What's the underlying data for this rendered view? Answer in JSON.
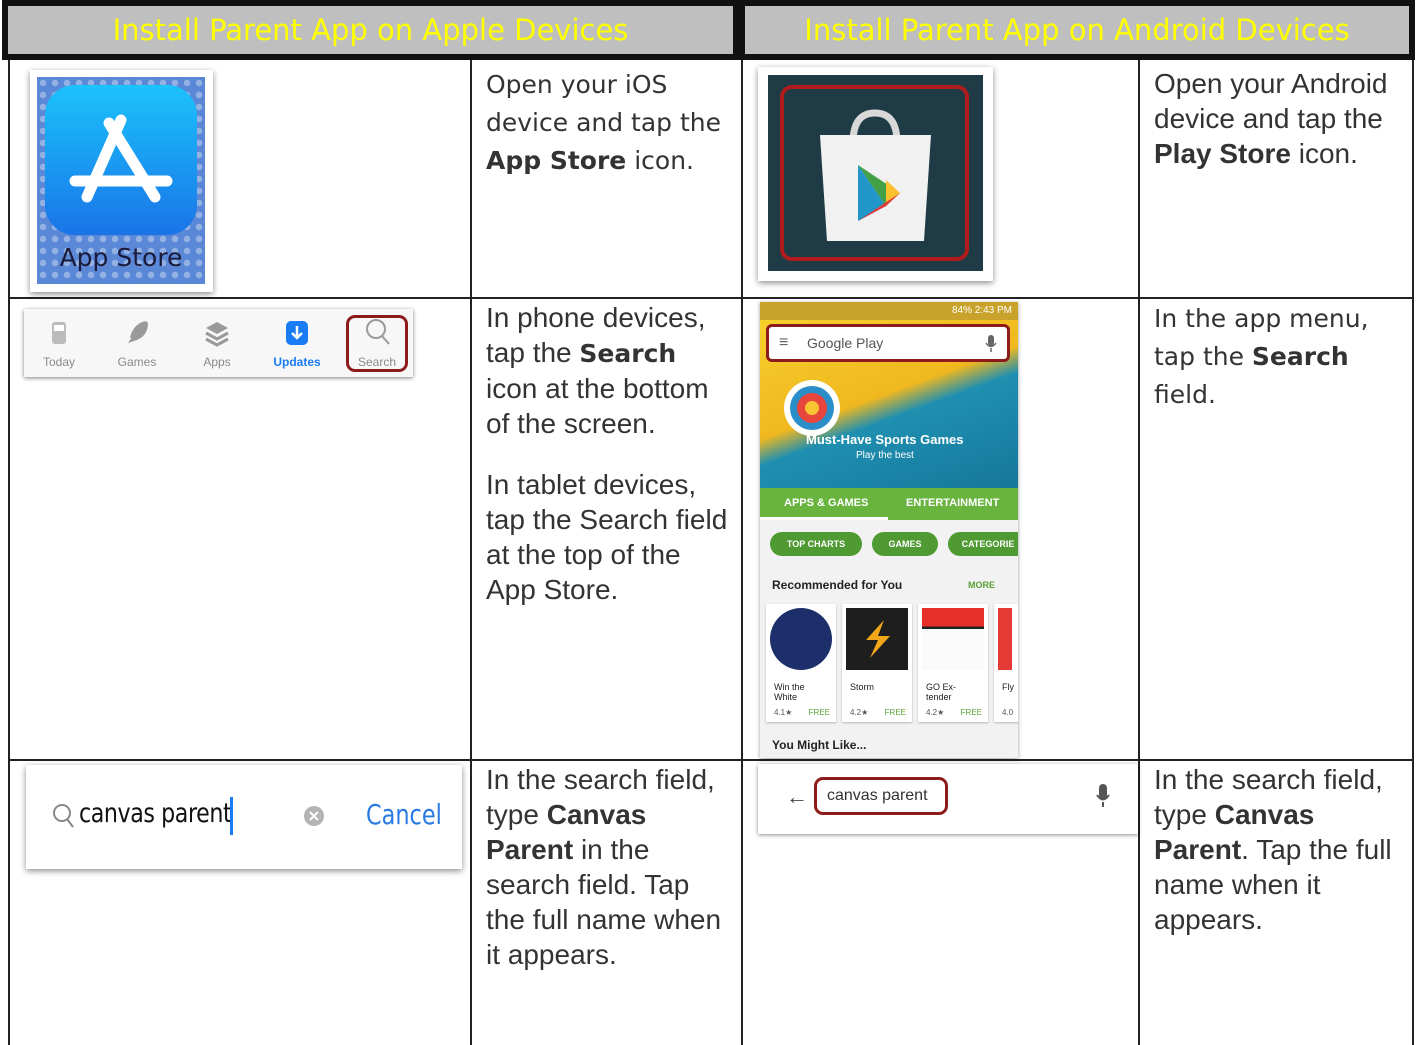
{
  "headers": {
    "apple": "Install Parent App on Apple Devices",
    "android": "Install Parent App on Android Devices"
  },
  "colors": {
    "header_bg": "#bfbfbf",
    "header_text": "#ffff00",
    "highlight": "#8e1b1b"
  },
  "apple": {
    "row1": {
      "icon_label": "App Store",
      "text_pre": "Open your iOS device and tap the",
      "text_bold": "App Store",
      "text_post": "icon."
    },
    "row2": {
      "tabs": [
        "Today",
        "Games",
        "Apps",
        "Updates",
        "Search"
      ],
      "phone_pre": "In phone devices, tap the",
      "phone_bold": "Search",
      "phone_post": "icon at the bottom of the screen.",
      "tablet": "In tablet devices, tap the Search field at the top of the App Store."
    },
    "row3": {
      "search_value": "canvas parent",
      "cancel_label": "Cancel",
      "text_pre": "In the search field, type",
      "text_bold": "Canvas Parent",
      "text_post": "in the search field. Tap the full name when it appears."
    }
  },
  "android": {
    "row1": {
      "text_pre": "Open your Android device and tap the",
      "text_bold": "Play Store",
      "text_post": "icon."
    },
    "row2": {
      "status": "84% 2:43 PM",
      "search_placeholder": "Google Play",
      "banner_title": "Must-Have Sports Games",
      "banner_sub": "Play the best",
      "tab_apps": "APPS & GAMES",
      "tab_ent": "ENTERTAINMENT",
      "chip_charts": "TOP CHARTS",
      "chip_games": "GAMES",
      "chip_cat": "CATEGORIE",
      "rec_heading": "Recommended for You",
      "more": "MORE",
      "apps": [
        {
          "name": "Win the White",
          "rating": "4.1★",
          "price": "FREE"
        },
        {
          "name": "Storm",
          "rating": "4.2★",
          "price": "FREE"
        },
        {
          "name": "GO Ex-tender",
          "rating": "4.2★",
          "price": "FREE"
        },
        {
          "name": "Fly",
          "rating": "4.0",
          "price": ""
        }
      ],
      "might_like": "You Might Like...",
      "text_pre": "In the app menu, tap the",
      "text_bold": "Search",
      "text_post": "field."
    },
    "row3": {
      "search_value": "canvas parent",
      "text_pre": "In the search field, type",
      "text_bold": "Canvas Parent",
      "text_post": ". Tap the full name when it appears."
    }
  }
}
